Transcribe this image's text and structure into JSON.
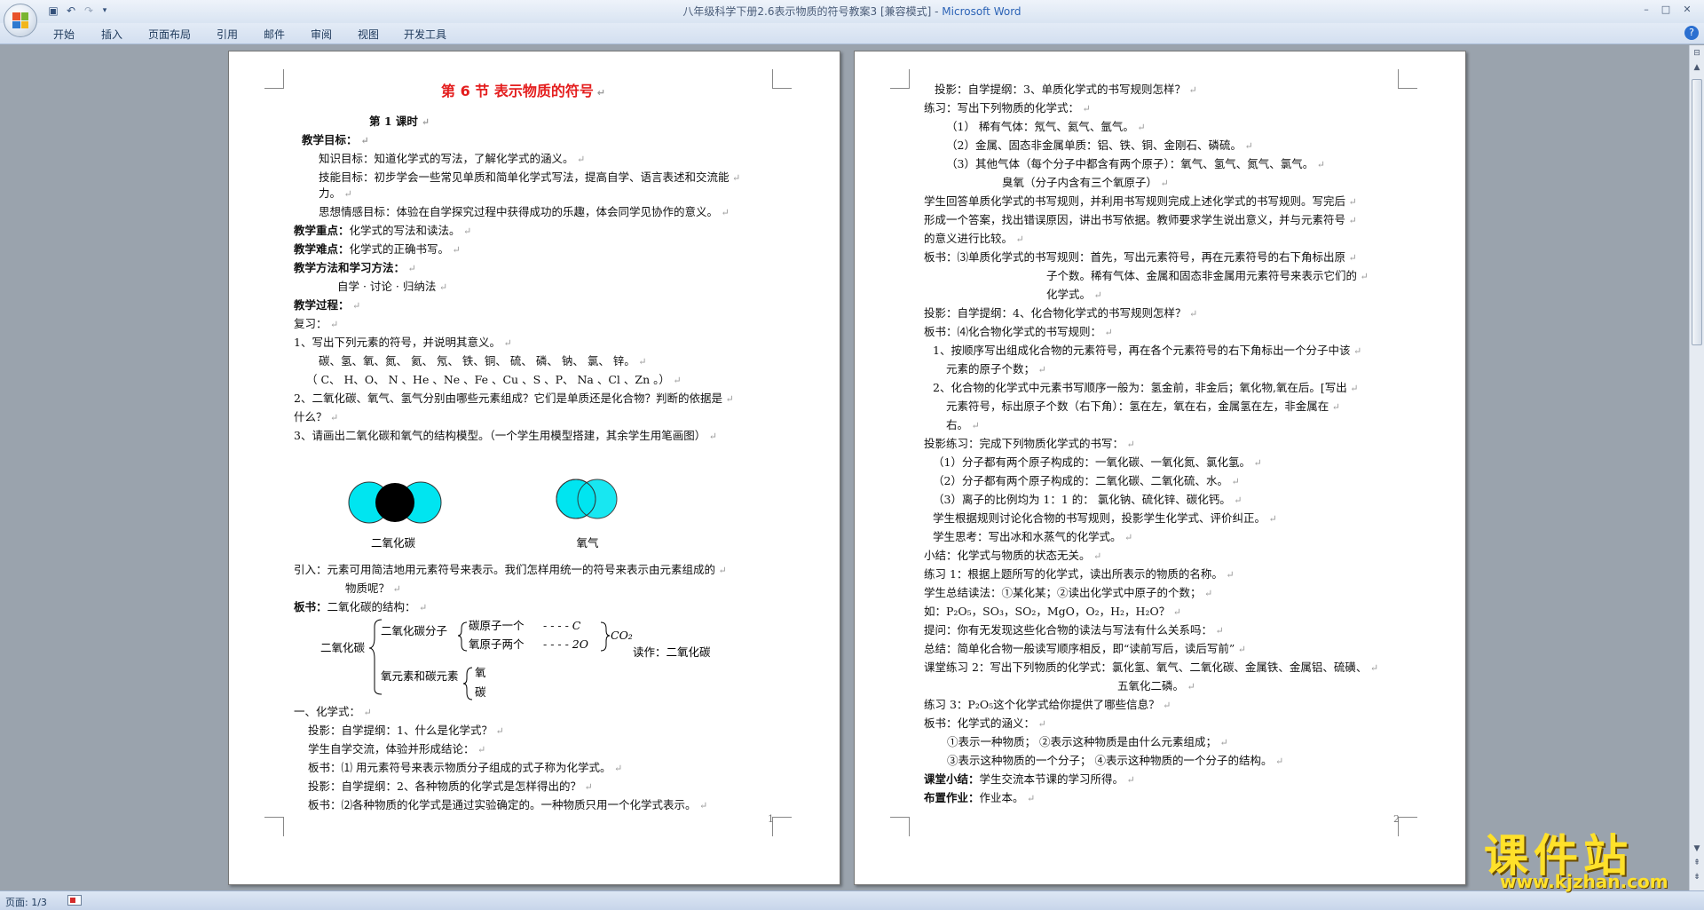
{
  "window": {
    "title": "八年级科学下册2.6表示物质的符号教案3 [兼容模式] - ",
    "app_name": "Microsoft Word"
  },
  "ribbon": {
    "tabs": [
      "开始",
      "插入",
      "页面布局",
      "引用",
      "邮件",
      "审阅",
      "视图",
      "开发工具"
    ]
  },
  "status": {
    "page": "页面: 1/3"
  },
  "page1": {
    "number": "1",
    "lines": [
      {
        "t": "第 6 节  表示物质的符号"
      },
      {
        "t": "第 1 课时"
      },
      {
        "t": "教学目标："
      },
      {
        "t": "知识目标：知道化学式的写法，了解化学式的涵义。"
      },
      {
        "t": "技能目标：初步学会一些常见单质和简单化学式写法，提高自学、语言表述和交流能"
      },
      {
        "t": "力。"
      },
      {
        "t": "思想情感目标：体验在自学探究过程中获得成功的乐趣，体会同学见协作的意义。"
      },
      {
        "t": "教学重点：化学式的写法和读法。"
      },
      {
        "t": "教学难点：化学式的正确书写。"
      },
      {
        "t": "教学方法和学习方法："
      },
      {
        "t": "自学 · 讨论 · 归纳法"
      },
      {
        "t": "教学过程："
      },
      {
        "t": "复习："
      },
      {
        "t": "1、写出下列元素的符号，并说明其意义。"
      },
      {
        "t": "碳、氢、氧、氮、  氦、  氖、    铁、铜、  硫、  磷、  钠、  氯、  锌。"
      },
      {
        "t": "（ C、 H、O、 N 、He 、Ne 、Fe 、Cu 、S 、P、 Na 、Cl 、Zn 。）"
      },
      {
        "t": "2、二氧化碳、氧气、氢气分别由哪些元素组成？它们是单质还是化合物？判断的依据是"
      },
      {
        "t": "什么？"
      },
      {
        "t": "3、请画出二氧化碳和氧气的结构模型。（一个学生用模型搭建，其余学生用笔画图）"
      },
      {
        "t": "引入：元素可用简洁地用元素符号来表示。我们怎样用统一的符号来表示由元素组成的"
      },
      {
        "t": "物质呢？"
      },
      {
        "t": "板书：二氧化碳的结构："
      },
      {
        "t": "一、化学式："
      },
      {
        "t": "投影：自学提纲：1、什么是化学式？"
      },
      {
        "t": "学生自学交流，体验并形成结论："
      },
      {
        "t": "板书：⑴ 用元素符号来表示物质分子组成的式子称为化学式。"
      },
      {
        "t": "投影：自学提纲：2、各种物质的化学式是怎样得出的？"
      },
      {
        "t": "板书：⑵各种物质的化学式是通过实验确定的。一种物质只用一个化学式表示。"
      }
    ],
    "model_labels": [
      "二氧化碳",
      "氧气"
    ],
    "diagram": {
      "root": "二氧化碳",
      "molecule": "二氧化碳分子",
      "c_atom": "碳原子一个",
      "o_atoms": "氧原子两个",
      "c_sym": "- - - - C",
      "o_sym": "- - - - 2O",
      "formula": "CO₂",
      "elements": "氧元素和碳元素",
      "el1": "氧",
      "el2": "碳",
      "reading": "读作：二氧化碳"
    }
  },
  "page2": {
    "number": "2",
    "lines": [
      {
        "t": "投影：自学提纲：3、单质化学式的书写规则怎样？"
      },
      {
        "t": "练习：写出下列物质的化学式："
      },
      {
        "t": "（1）  稀有气体：氖气、氦气、氩气。"
      },
      {
        "t": "（2）金属、固态非金属单质：铝、铁、铜、金刚石、磷硫。"
      },
      {
        "t": "（3）其他气体（每个分子中都含有两个原子）：氧气、氢气、氮气、氯气。"
      },
      {
        "t": "臭氧（分子内含有三个氧原子）"
      },
      {
        "t": "学生回答单质化学式的书写规则，并利用书写规则完成上述化学式的书写规则。写完后"
      },
      {
        "t": "形成一个答案，找出错误原因，讲出书写依据。教师要求学生说出意义，并与元素符号"
      },
      {
        "t": "的意义进行比较。"
      },
      {
        "t": "板书：⑶单质化学式的书写规则：首先，写出元素符号，再在元素符号的右下角标出原"
      },
      {
        "t": "子个数。稀有气体、金属和固态非金属用元素符号来表示它们的"
      },
      {
        "t": "化学式。"
      },
      {
        "t": "投影：自学提纲：4、化合物化学式的书写规则怎样？"
      },
      {
        "t": "板书：⑷化合物化学式的书写规则："
      },
      {
        "t": "1、按顺序写出组成化合物的元素符号，再在各个元素符号的右下角标出一个分子中该"
      },
      {
        "t": "元素的原子个数；"
      },
      {
        "t": "2、化合物的化学式中元素书写顺序一般为：氢金前，非金后；氧化物,氧在后。[写出"
      },
      {
        "t": "元素符号，标出原子个数（右下角）：氢在左，氧在右，金属氢在左，非金属在"
      },
      {
        "t": "右。"
      },
      {
        "t": "投影练习：完成下列物质化学式的书写："
      },
      {
        "t": "（1）分子都有两个原子构成的：一氧化碳、一氧化氮、氯化氢。"
      },
      {
        "t": "（2）分子都有两个原子构成的：二氧化碳、二氧化硫、水。"
      },
      {
        "t": "（3）离子的比例均为 1：1 的：  氯化钠、硫化锌、碳化钙。"
      },
      {
        "t": "学生根据规则讨论化合物的书写规则，投影学生化学式、评价纠正。"
      },
      {
        "t": "学生思考：写出冰和水蒸气的化学式。"
      },
      {
        "t": "小结：化学式与物质的状态无关。"
      },
      {
        "t": "练习 1：根据上题所写的化学式，读出所表示的物质的名称。"
      },
      {
        "t": "学生总结读法：①某化某；②读出化学式中原子的个数；"
      },
      {
        "t": "如：P₂O₅，SO₃，SO₂，MgO，O₂，H₂，H₂O？"
      },
      {
        "t": "提问：你有无发现这些化合物的读法与写法有什么关系吗："
      },
      {
        "t": "总结：简单化合物一般读写顺序相反，即“读前写后，读后写前”"
      },
      {
        "t": "课堂练习 2：写出下列物质的化学式：氯化氢、氧气、二氧化碳、金属铁、金属铝、硫磺、"
      },
      {
        "t": "五氧化二磷。"
      },
      {
        "t": "练习 3：P₂O₅这个化学式给你提供了哪些信息？"
      },
      {
        "t": "板书：化学式的涵义："
      },
      {
        "t": "①表示一种物质；          ②表示这种物质是由什么元素组成；"
      },
      {
        "t": "③表示这种物质的一个分子；     ④表示这种物质的一个分子的结构。"
      },
      {
        "t": "课堂小结：学生交流本节课的学习所得。"
      },
      {
        "t": "布置作业：作业本。"
      }
    ]
  },
  "watermark": {
    "title": "课件站",
    "url": "www.kjzhan.com"
  },
  "colors": {
    "heading_red": "#e41e1e",
    "model_cyan": "#00e5f0",
    "model_black": "#000000",
    "watermark_yellow": "#ffe12a"
  }
}
